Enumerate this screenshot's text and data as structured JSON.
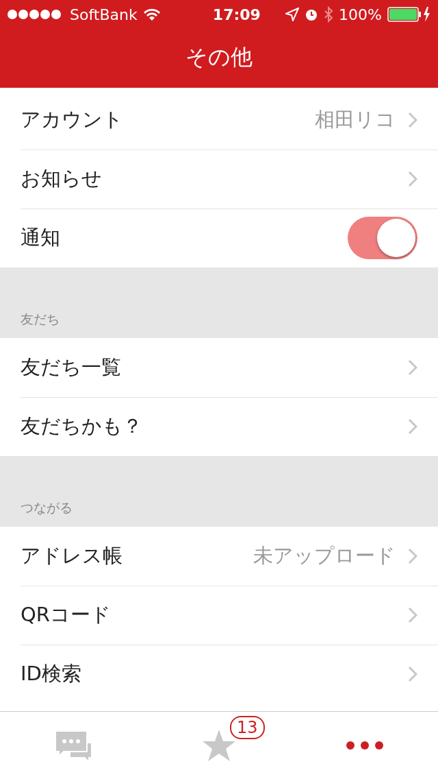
{
  "status_bar": {
    "carrier": "SoftBank",
    "time": "17:09",
    "battery": "100%"
  },
  "nav": {
    "title": "その他"
  },
  "sections": [
    {
      "rows": [
        {
          "kind": "link",
          "label": "アカウント",
          "value": "相田リコ"
        },
        {
          "kind": "link",
          "label": "お知らせ"
        },
        {
          "kind": "toggle",
          "label": "通知",
          "on": true
        }
      ]
    },
    {
      "header": "友だち",
      "rows": [
        {
          "kind": "link",
          "label": "友だち一覧"
        },
        {
          "kind": "link",
          "label": "友だちかも？"
        }
      ]
    },
    {
      "header": "つながる",
      "rows": [
        {
          "kind": "link",
          "label": "アドレス帳",
          "value": "未アップロード"
        },
        {
          "kind": "link",
          "label": "QRコード"
        },
        {
          "kind": "link",
          "label": "ID検索"
        }
      ]
    }
  ],
  "tab_bar": [
    {
      "kind": "chat",
      "selected": false
    },
    {
      "kind": "star",
      "selected": false,
      "badge": "13"
    },
    {
      "kind": "more",
      "selected": true
    }
  ]
}
